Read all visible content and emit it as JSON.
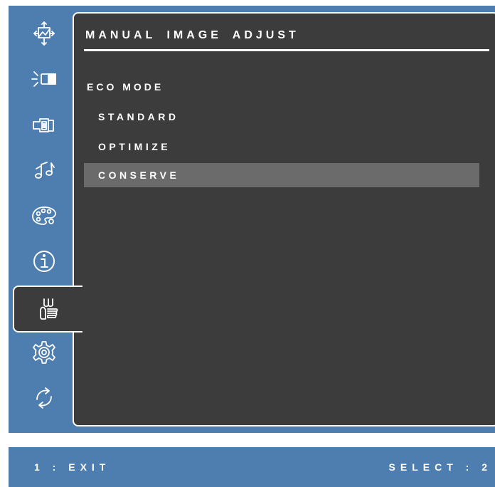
{
  "sidebar": {
    "items": [
      {
        "name": "image-position-icon"
      },
      {
        "name": "brightness-contrast-icon"
      },
      {
        "name": "input-select-icon"
      },
      {
        "name": "audio-icon"
      },
      {
        "name": "color-palette-icon"
      },
      {
        "name": "information-icon"
      },
      {
        "name": "manual-image-adjust-icon",
        "active": true
      },
      {
        "name": "setup-menu-icon"
      },
      {
        "name": "memory-recall-icon"
      }
    ]
  },
  "panel": {
    "title": "MANUAL IMAGE ADJUST",
    "heading": "ECO MODE",
    "options": [
      "STANDARD",
      "OPTIMIZE",
      "CONSERVE"
    ],
    "selected_option": "CONSERVE"
  },
  "footer": {
    "left": "1 : EXIT",
    "right": "SELECT : 2"
  },
  "colors": {
    "osd_blue": "#4e7eaf",
    "panel_bg": "#3c3c3c",
    "highlight": "#6b6b6b",
    "text": "#ffffff"
  }
}
